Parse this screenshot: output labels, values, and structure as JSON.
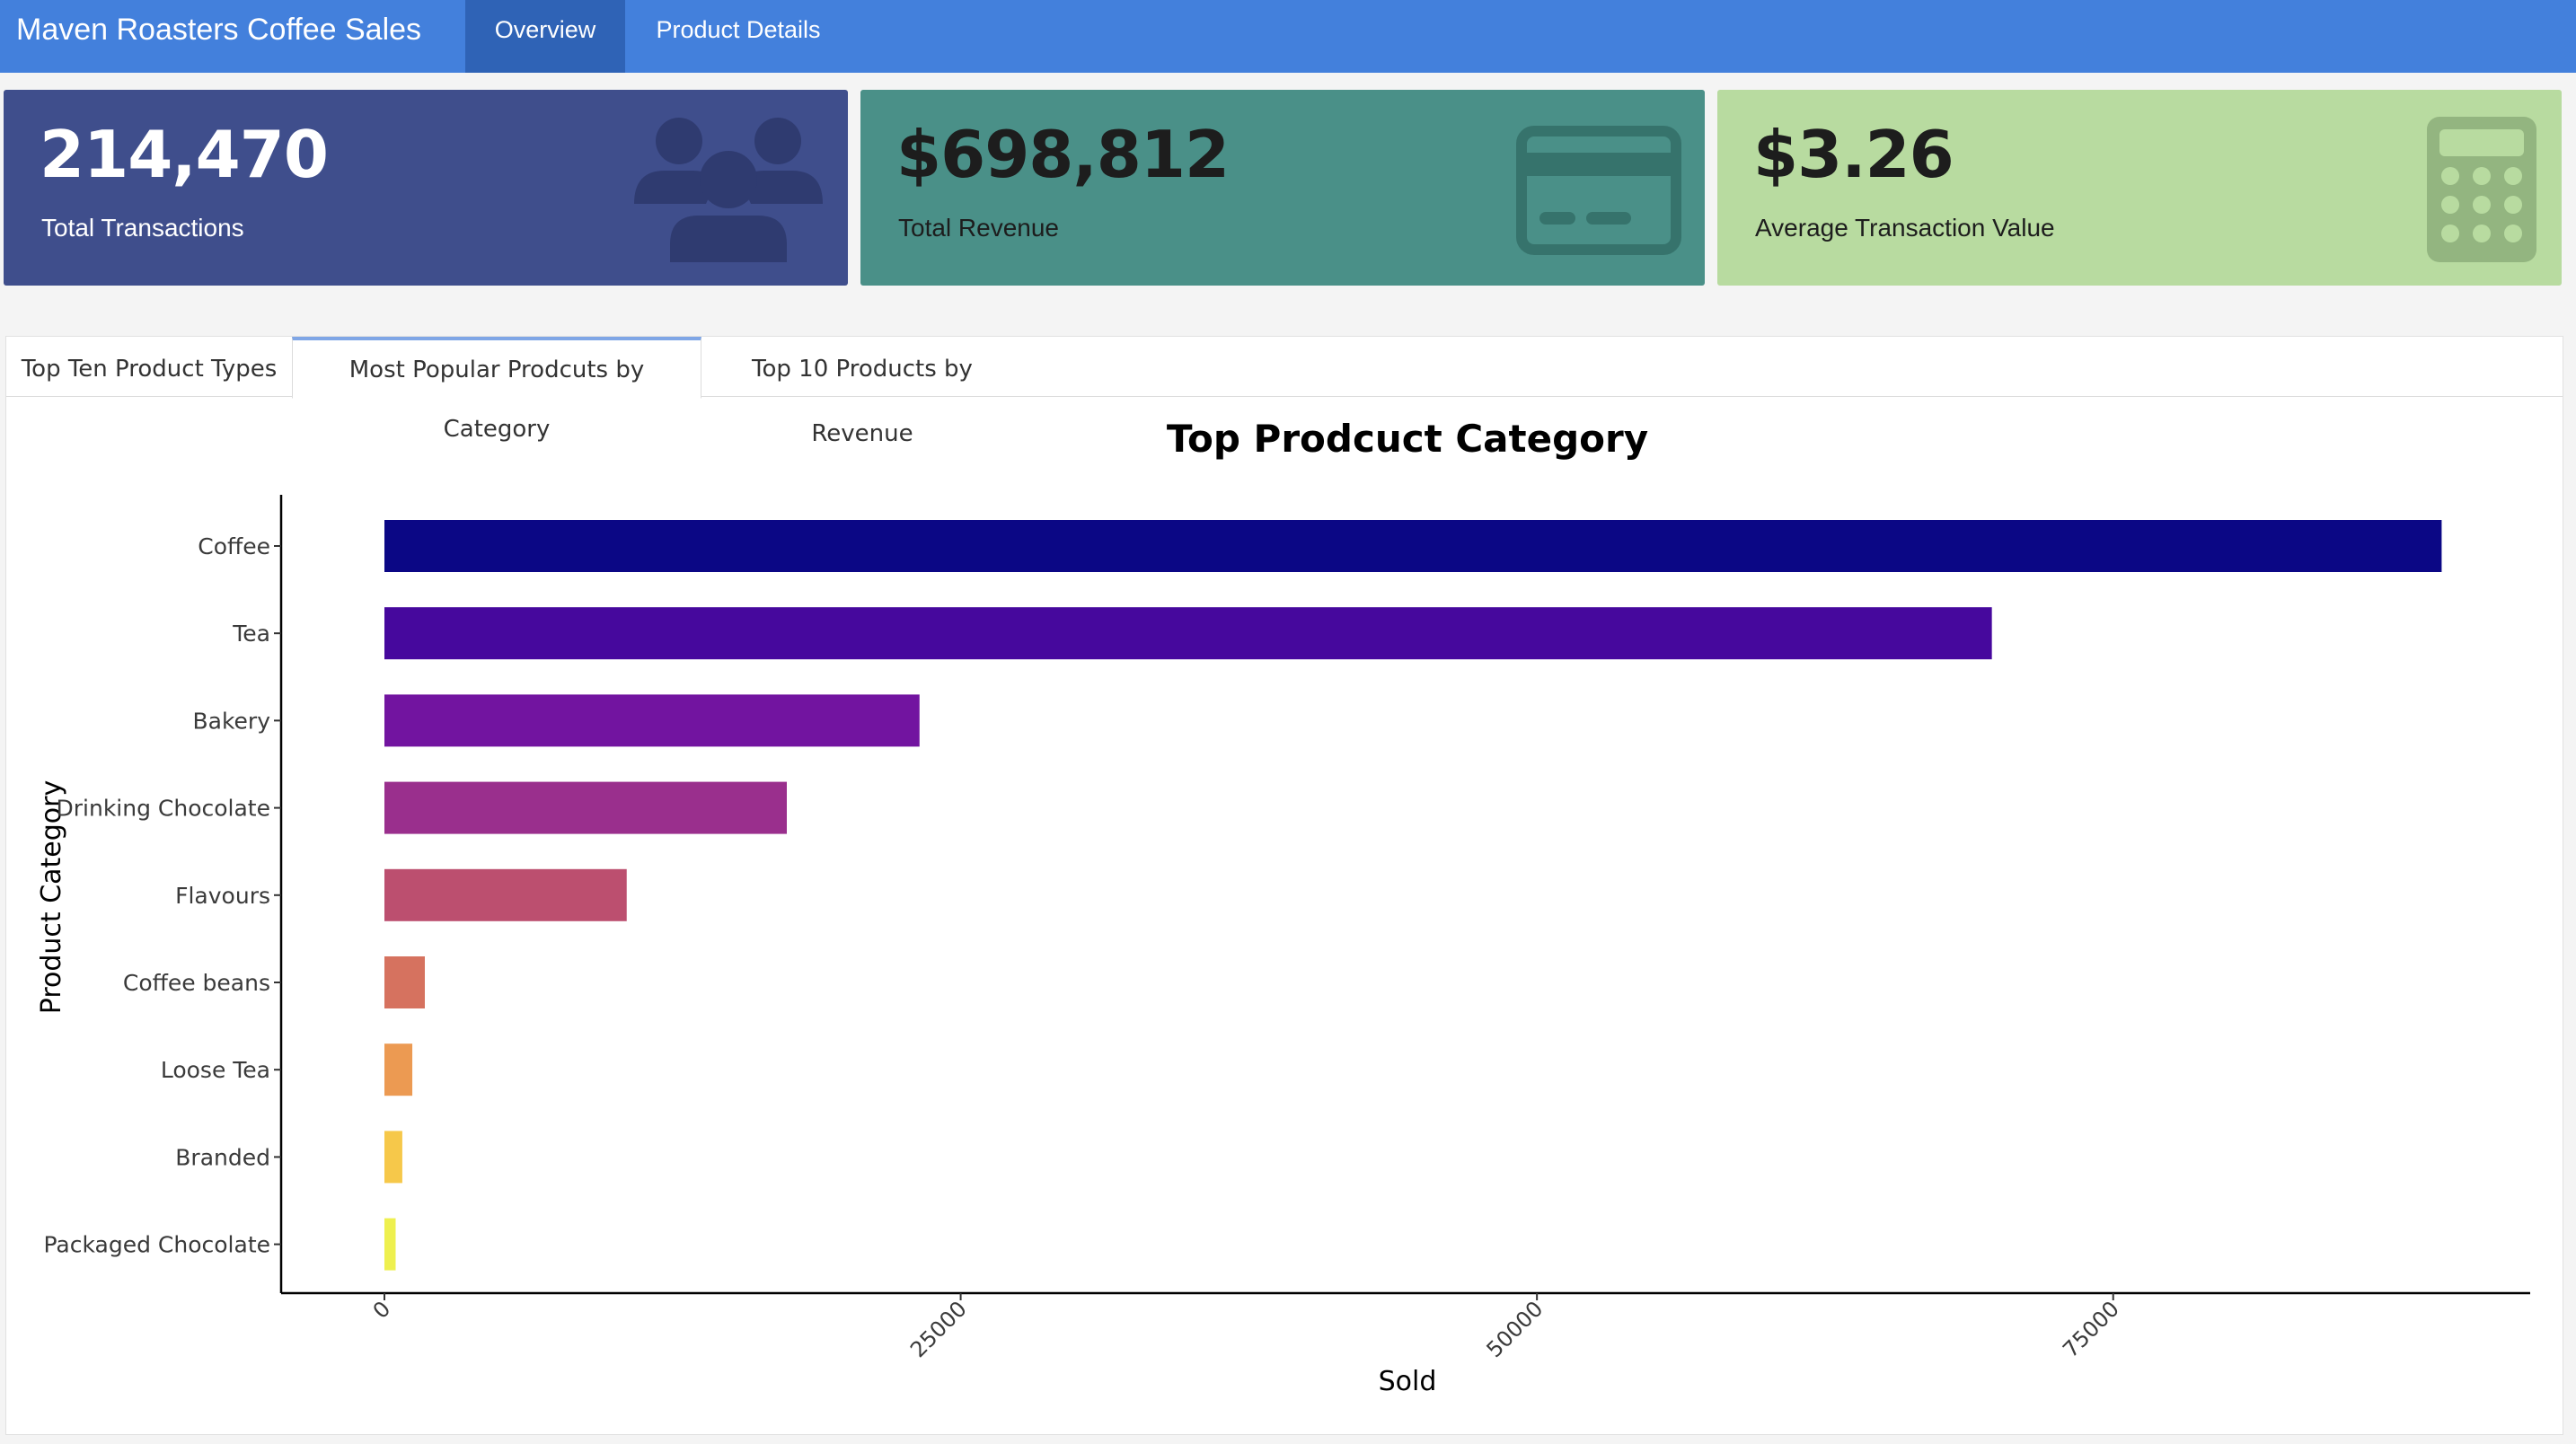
{
  "app": {
    "title": "Maven Roasters Coffee Sales",
    "nav": [
      {
        "label": "Overview",
        "active": true
      },
      {
        "label": "Product Details",
        "active": false
      }
    ]
  },
  "value_boxes": [
    {
      "value": "214,470",
      "label": "Total Transactions",
      "icon": "users-icon",
      "color": "#3f4e8c"
    },
    {
      "value": "$698,812",
      "label": "Total Revenue",
      "icon": "credit-card-icon",
      "color": "#4a9088"
    },
    {
      "value": "$3.26",
      "label": "Average Transaction Value",
      "icon": "calculator-icon",
      "color": "#b8dba0"
    }
  ],
  "tabs": [
    {
      "label": "Top Ten Product Types",
      "active": false
    },
    {
      "label": "Most Popular Prodcuts by Category",
      "active": true
    },
    {
      "label": "Top 10 Products by Revenue",
      "active": false
    }
  ],
  "chart_data": {
    "type": "bar",
    "orientation": "horizontal",
    "title": "Top Prodcuct Category",
    "xlabel": "Sold",
    "ylabel": "Product Category",
    "xlim": [
      0,
      89000
    ],
    "xticks": [
      "0",
      "25000",
      "50000",
      "75000"
    ],
    "categories": [
      "Coffee",
      "Tea",
      "Bakery",
      "Drinking Chocolate",
      "Flavours",
      "Coffee beans",
      "Loose Tea",
      "Branded",
      "Packaged Chocolate"
    ],
    "values": [
      89250,
      69737,
      23214,
      17457,
      10511,
      1753,
      1210,
      776,
      487
    ],
    "colors": [
      "#0d0887",
      "#46039f",
      "#7201a8",
      "#9c179e",
      "#bd3786",
      "#d8576b",
      "#ed7953",
      "#fb9f3a",
      "#fdca26"
    ],
    "bar_colors_actual": [
      "#0b0785",
      "#46089d",
      "#7214a0",
      "#9a2f8d",
      "#bc4f6f",
      "#d6725f",
      "#ec9a52",
      "#f6c84a",
      "#eef04f"
    ]
  }
}
